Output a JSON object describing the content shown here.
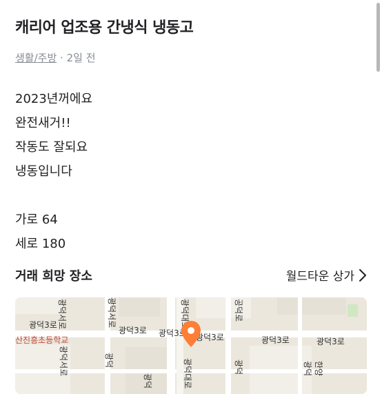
{
  "post": {
    "title": "캐리어 업조용 간냉식 냉동고",
    "category": "생활/주방",
    "time": "2일 전",
    "description": [
      "2023년꺼에요",
      "완전새거!!",
      "작동도 잘되요",
      "냉동입니다",
      "",
      "가로 64",
      "세로 180"
    ]
  },
  "location": {
    "label": "거래 희망 장소",
    "value": "월드타운 상가"
  },
  "map": {
    "labels": {
      "road_1": "광덕3로",
      "road_2": "광덕3로",
      "road_3": "광덕3로",
      "road_4": "광덕3로",
      "road_5": "광덕3로",
      "road_6": "광덕3로",
      "school": "산진흥초등학교",
      "v_road_1": "광덕서로",
      "v_road_2": "광덕서로",
      "v_road_3": "광덕대로",
      "v_road_4": "광덕대로",
      "v_road_5": "공덕로",
      "v_road_6": "광덕",
      "v_road_7": "광덕",
      "v_road_8": "광덕",
      "v_road_9": "한양"
    },
    "pin_color": "#ff7e36"
  }
}
